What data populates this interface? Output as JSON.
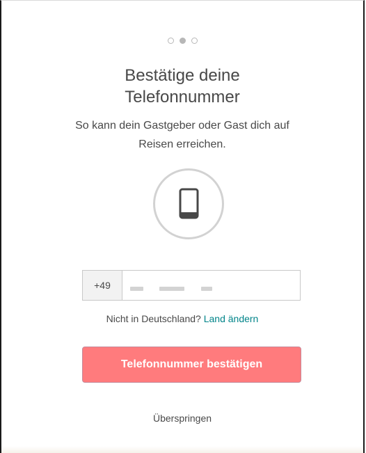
{
  "progress": {
    "step": 2,
    "total": 3
  },
  "header": {
    "title_line1": "Bestätige deine",
    "title_line2": "Telefonnummer"
  },
  "subtitle": {
    "line1": "So kann dein Gastgeber oder Gast dich auf",
    "line2": "Reisen erreichen."
  },
  "icon": {
    "name": "mobile-phone-icon"
  },
  "phone": {
    "country_code": "+49",
    "value_masked": true
  },
  "country": {
    "prompt": "Nicht in Deutschland?",
    "change_link": "Land ändern"
  },
  "actions": {
    "confirm_label": "Telefonnummer bestätigen",
    "skip_label": "Überspringen"
  },
  "colors": {
    "primary_button": "#ff7b7d",
    "link": "#008489",
    "text": "#484848",
    "icon_gray": "#d2d2d2"
  }
}
